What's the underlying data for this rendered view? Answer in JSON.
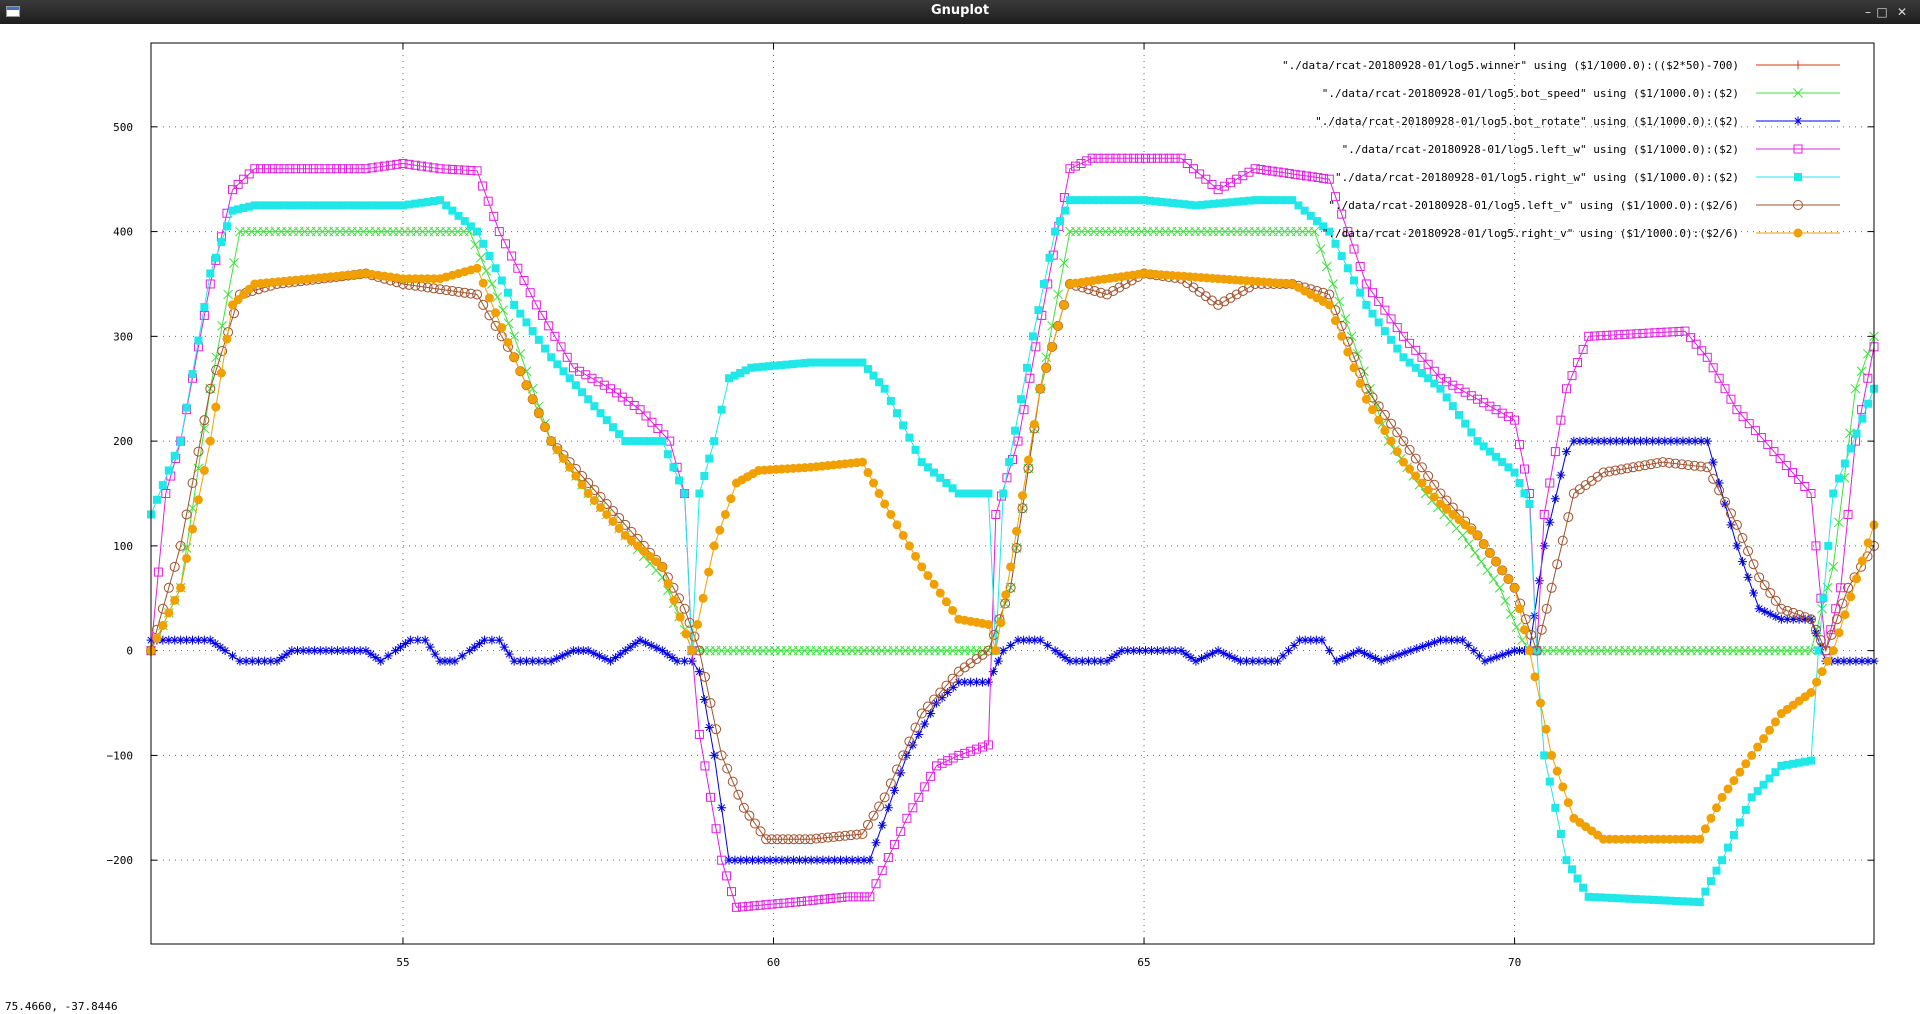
{
  "window": {
    "title": "Gnuplot",
    "coords_readout": "75.4660, -37.8446",
    "icons": [
      "app-icon",
      "minimize-icon",
      "maximize-icon",
      "close-icon"
    ]
  },
  "chart_data": {
    "type": "line",
    "xlim": [
      51.6,
      74.85
    ],
    "ylim": [
      -280,
      580
    ],
    "x_ticks": [
      55,
      60,
      65,
      70
    ],
    "y_ticks": [
      -200,
      -100,
      0,
      100,
      200,
      300,
      400,
      500
    ],
    "grid": true,
    "legend_position": "top-right",
    "series": [
      {
        "name": "\"./data/rcat-20180928-01/log5.winner\" using ($1/1000.0):(($2*50)-700)",
        "color": "#e0301e",
        "marker": "plus",
        "points": []
      },
      {
        "name": "\"./data/rcat-20180928-01/log5.bot_speed\" using ($1/1000.0):($2)",
        "color": "#40e040",
        "marker": "cross",
        "points": [
          [
            51.6,
            0
          ],
          [
            52.0,
            60
          ],
          [
            52.4,
            250
          ],
          [
            52.8,
            400
          ],
          [
            55.9,
            400
          ],
          [
            56.5,
            300
          ],
          [
            57.0,
            200
          ],
          [
            57.5,
            150
          ],
          [
            58.0,
            110
          ],
          [
            58.5,
            70
          ],
          [
            58.8,
            20
          ],
          [
            58.9,
            0
          ],
          [
            62.9,
            0
          ],
          [
            63.2,
            60
          ],
          [
            63.6,
            250
          ],
          [
            64.0,
            400
          ],
          [
            67.3,
            400
          ],
          [
            67.8,
            300
          ],
          [
            68.3,
            200
          ],
          [
            68.8,
            150
          ],
          [
            69.3,
            110
          ],
          [
            69.8,
            60
          ],
          [
            70.1,
            10
          ],
          [
            70.2,
            0
          ],
          [
            74.0,
            0
          ],
          [
            74.3,
            80
          ],
          [
            74.6,
            250
          ],
          [
            74.85,
            300
          ]
        ]
      },
      {
        "name": "\"./data/rcat-20180928-01/log5.bot_rotate\" using ($1/1000.0):($2)",
        "color": "#0000e0",
        "marker": "star",
        "points": [
          [
            51.6,
            10
          ],
          [
            52.4,
            10
          ],
          [
            52.6,
            0
          ],
          [
            52.8,
            -10
          ],
          [
            53.3,
            -10
          ],
          [
            53.5,
            0
          ],
          [
            54.5,
            0
          ],
          [
            54.7,
            -10
          ],
          [
            54.9,
            0
          ],
          [
            55.1,
            10
          ],
          [
            55.3,
            10
          ],
          [
            55.5,
            -10
          ],
          [
            55.7,
            -10
          ],
          [
            55.9,
            0
          ],
          [
            56.1,
            10
          ],
          [
            56.3,
            10
          ],
          [
            56.5,
            -10
          ],
          [
            57.0,
            -10
          ],
          [
            57.3,
            0
          ],
          [
            57.5,
            0
          ],
          [
            57.8,
            -10
          ],
          [
            58.0,
            0
          ],
          [
            58.2,
            10
          ],
          [
            58.5,
            0
          ],
          [
            58.7,
            -10
          ],
          [
            58.9,
            -10
          ],
          [
            59.0,
            -20
          ],
          [
            59.2,
            -100
          ],
          [
            59.4,
            -200
          ],
          [
            61.3,
            -200
          ],
          [
            61.8,
            -100
          ],
          [
            62.2,
            -50
          ],
          [
            62.5,
            -30
          ],
          [
            62.9,
            -30
          ],
          [
            63.1,
            0
          ],
          [
            63.3,
            10
          ],
          [
            63.6,
            10
          ],
          [
            63.8,
            0
          ],
          [
            64.0,
            -10
          ],
          [
            64.5,
            -10
          ],
          [
            64.7,
            0
          ],
          [
            65.5,
            0
          ],
          [
            65.7,
            -10
          ],
          [
            66.0,
            0
          ],
          [
            66.3,
            -10
          ],
          [
            66.8,
            -10
          ],
          [
            67.1,
            10
          ],
          [
            67.4,
            10
          ],
          [
            67.6,
            -10
          ],
          [
            67.9,
            0
          ],
          [
            68.2,
            -10
          ],
          [
            68.6,
            0
          ],
          [
            69.0,
            10
          ],
          [
            69.3,
            10
          ],
          [
            69.6,
            -10
          ],
          [
            70.0,
            0
          ],
          [
            70.2,
            0
          ],
          [
            70.4,
            100
          ],
          [
            70.7,
            190
          ],
          [
            70.8,
            200
          ],
          [
            72.6,
            200
          ],
          [
            73.0,
            100
          ],
          [
            73.3,
            40
          ],
          [
            73.6,
            30
          ],
          [
            74.0,
            30
          ],
          [
            74.2,
            -10
          ],
          [
            74.85,
            -10
          ]
        ]
      },
      {
        "name": "\"./data/rcat-20180928-01/log5.left_w\" using ($1/1000.0):($2)",
        "color": "#e020e0",
        "marker": "square",
        "points": [
          [
            51.6,
            0
          ],
          [
            51.8,
            150
          ],
          [
            52.0,
            200
          ],
          [
            52.4,
            350
          ],
          [
            52.7,
            440
          ],
          [
            53.0,
            460
          ],
          [
            54.5,
            460
          ],
          [
            55.0,
            465
          ],
          [
            55.5,
            460
          ],
          [
            56.0,
            458
          ],
          [
            56.3,
            400
          ],
          [
            56.8,
            330
          ],
          [
            57.3,
            270
          ],
          [
            57.8,
            250
          ],
          [
            58.2,
            230
          ],
          [
            58.6,
            200
          ],
          [
            58.8,
            150
          ],
          [
            58.9,
            0
          ],
          [
            59.0,
            -80
          ],
          [
            59.3,
            -200
          ],
          [
            59.5,
            -245
          ],
          [
            60.3,
            -240
          ],
          [
            61.0,
            -235
          ],
          [
            61.3,
            -235
          ],
          [
            61.8,
            -160
          ],
          [
            62.2,
            -110
          ],
          [
            62.5,
            -100
          ],
          [
            62.9,
            -90
          ],
          [
            63.0,
            130
          ],
          [
            63.3,
            200
          ],
          [
            63.7,
            350
          ],
          [
            64.0,
            460
          ],
          [
            64.3,
            470
          ],
          [
            65.5,
            470
          ],
          [
            66.0,
            440
          ],
          [
            66.5,
            460
          ],
          [
            67.5,
            450
          ],
          [
            68.0,
            350
          ],
          [
            68.5,
            300
          ],
          [
            69.0,
            260
          ],
          [
            69.5,
            240
          ],
          [
            70.0,
            220
          ],
          [
            70.2,
            150
          ],
          [
            70.3,
            0
          ],
          [
            70.4,
            130
          ],
          [
            70.7,
            250
          ],
          [
            71.0,
            300
          ],
          [
            72.3,
            305
          ],
          [
            72.6,
            280
          ],
          [
            73.0,
            230
          ],
          [
            73.5,
            190
          ],
          [
            74.0,
            150
          ],
          [
            74.2,
            0
          ],
          [
            74.4,
            60
          ],
          [
            74.6,
            200
          ],
          [
            74.85,
            290
          ]
        ]
      },
      {
        "name": "\"./data/rcat-20180928-01/log5.right_w\" using ($1/1000.0):($2)",
        "color": "#20e8e8",
        "marker": "filled-square",
        "points": [
          [
            51.6,
            130
          ],
          [
            52.0,
            200
          ],
          [
            52.4,
            360
          ],
          [
            52.7,
            420
          ],
          [
            53.0,
            425
          ],
          [
            54.5,
            425
          ],
          [
            55.0,
            425
          ],
          [
            55.5,
            430
          ],
          [
            56.0,
            400
          ],
          [
            56.5,
            330
          ],
          [
            57.0,
            280
          ],
          [
            57.5,
            240
          ],
          [
            58.0,
            200
          ],
          [
            58.5,
            200
          ],
          [
            58.8,
            150
          ],
          [
            58.9,
            0
          ],
          [
            59.0,
            150
          ],
          [
            59.2,
            200
          ],
          [
            59.4,
            260
          ],
          [
            59.7,
            270
          ],
          [
            60.5,
            275
          ],
          [
            61.2,
            275
          ],
          [
            61.5,
            250
          ],
          [
            62.0,
            180
          ],
          [
            62.5,
            150
          ],
          [
            62.9,
            150
          ],
          [
            63.0,
            0
          ],
          [
            63.1,
            150
          ],
          [
            63.5,
            300
          ],
          [
            63.8,
            400
          ],
          [
            64.0,
            430
          ],
          [
            65.0,
            430
          ],
          [
            65.7,
            425
          ],
          [
            66.5,
            430
          ],
          [
            67.0,
            430
          ],
          [
            67.5,
            400
          ],
          [
            68.0,
            330
          ],
          [
            68.5,
            280
          ],
          [
            69.0,
            250
          ],
          [
            69.5,
            200
          ],
          [
            70.0,
            170
          ],
          [
            70.2,
            140
          ],
          [
            70.3,
            0
          ],
          [
            70.4,
            -100
          ],
          [
            70.7,
            -200
          ],
          [
            71.0,
            -235
          ],
          [
            72.5,
            -240
          ],
          [
            72.8,
            -200
          ],
          [
            73.2,
            -140
          ],
          [
            73.6,
            -110
          ],
          [
            74.0,
            -105
          ],
          [
            74.1,
            0
          ],
          [
            74.3,
            150
          ],
          [
            74.85,
            250
          ]
        ]
      },
      {
        "name": "\"./data/rcat-20180928-01/log5.left_v\" using ($1/1000.0):($2/6)",
        "color": "#a0522d",
        "marker": "circle",
        "points": [
          [
            51.6,
            0
          ],
          [
            52.0,
            100
          ],
          [
            52.4,
            250
          ],
          [
            52.8,
            340
          ],
          [
            53.3,
            350
          ],
          [
            54.5,
            360
          ],
          [
            55.0,
            350
          ],
          [
            55.5,
            345
          ],
          [
            56.0,
            340
          ],
          [
            56.5,
            280
          ],
          [
            57.0,
            200
          ],
          [
            57.5,
            160
          ],
          [
            58.0,
            120
          ],
          [
            58.5,
            80
          ],
          [
            58.8,
            40
          ],
          [
            59.0,
            0
          ],
          [
            59.3,
            -100
          ],
          [
            59.6,
            -150
          ],
          [
            59.9,
            -180
          ],
          [
            60.5,
            -180
          ],
          [
            61.2,
            -175
          ],
          [
            61.5,
            -140
          ],
          [
            62.0,
            -60
          ],
          [
            62.5,
            -20
          ],
          [
            62.9,
            0
          ],
          [
            63.2,
            60
          ],
          [
            63.6,
            250
          ],
          [
            64.0,
            350
          ],
          [
            64.5,
            340
          ],
          [
            65.0,
            360
          ],
          [
            65.5,
            355
          ],
          [
            66.0,
            330
          ],
          [
            66.5,
            350
          ],
          [
            67.0,
            350
          ],
          [
            67.5,
            340
          ],
          [
            68.0,
            250
          ],
          [
            68.5,
            200
          ],
          [
            69.0,
            150
          ],
          [
            69.5,
            110
          ],
          [
            70.0,
            60
          ],
          [
            70.3,
            0
          ],
          [
            70.5,
            60
          ],
          [
            70.8,
            150
          ],
          [
            71.2,
            170
          ],
          [
            72.0,
            180
          ],
          [
            72.6,
            175
          ],
          [
            73.0,
            120
          ],
          [
            73.3,
            70
          ],
          [
            73.6,
            40
          ],
          [
            74.0,
            30
          ],
          [
            74.2,
            0
          ],
          [
            74.5,
            60
          ],
          [
            74.85,
            100
          ]
        ]
      },
      {
        "name": "\"./data/rcat-20180928-01/log5.right_v\" using ($1/1000.0):($2/6)",
        "color": "#f0a000",
        "marker": "filled-circle",
        "points": [
          [
            51.6,
            0
          ],
          [
            52.0,
            60
          ],
          [
            52.4,
            200
          ],
          [
            52.7,
            330
          ],
          [
            53.0,
            350
          ],
          [
            54.5,
            360
          ],
          [
            55.0,
            355
          ],
          [
            55.5,
            355
          ],
          [
            56.0,
            365
          ],
          [
            56.5,
            280
          ],
          [
            57.0,
            200
          ],
          [
            57.5,
            150
          ],
          [
            58.0,
            110
          ],
          [
            58.5,
            80
          ],
          [
            58.9,
            0
          ],
          [
            59.2,
            100
          ],
          [
            59.5,
            160
          ],
          [
            59.8,
            172
          ],
          [
            60.5,
            175
          ],
          [
            61.2,
            180
          ],
          [
            61.5,
            140
          ],
          [
            62.0,
            80
          ],
          [
            62.5,
            30
          ],
          [
            62.9,
            25
          ],
          [
            63.0,
            0
          ],
          [
            63.2,
            80
          ],
          [
            63.6,
            250
          ],
          [
            64.0,
            350
          ],
          [
            65.0,
            360
          ],
          [
            66.0,
            355
          ],
          [
            67.0,
            350
          ],
          [
            67.5,
            330
          ],
          [
            68.0,
            240
          ],
          [
            68.5,
            180
          ],
          [
            69.0,
            140
          ],
          [
            69.5,
            110
          ],
          [
            70.0,
            60
          ],
          [
            70.2,
            0
          ],
          [
            70.5,
            -100
          ],
          [
            70.8,
            -160
          ],
          [
            71.2,
            -180
          ],
          [
            72.5,
            -180
          ],
          [
            72.8,
            -140
          ],
          [
            73.2,
            -100
          ],
          [
            73.6,
            -60
          ],
          [
            74.0,
            -40
          ],
          [
            74.3,
            0
          ],
          [
            74.85,
            120
          ]
        ]
      }
    ]
  }
}
